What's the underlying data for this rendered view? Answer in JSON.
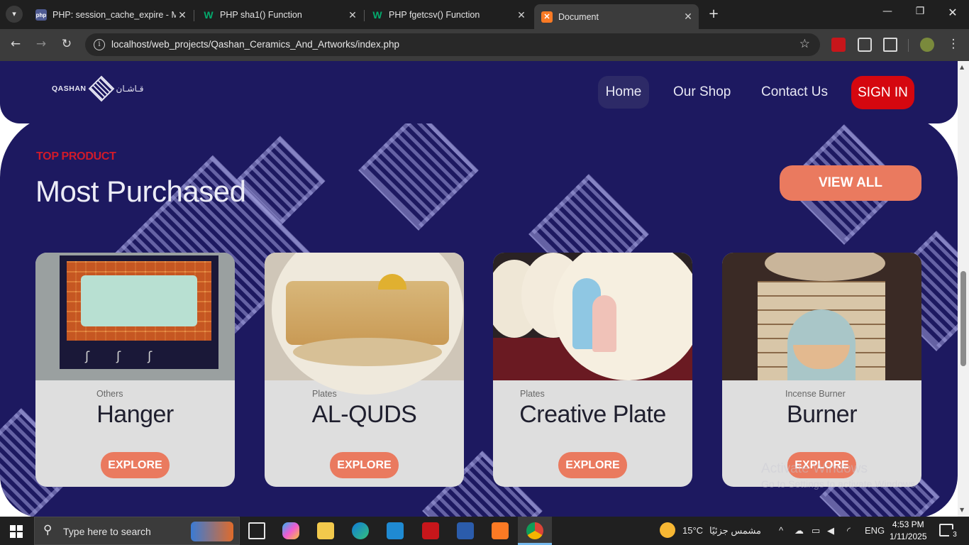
{
  "browser": {
    "tabs": [
      {
        "title": "PHP: session_cache_expire - Ma",
        "icon": "php-icon"
      },
      {
        "title": "PHP sha1() Function",
        "icon": "w3schools-icon"
      },
      {
        "title": "PHP fgetcsv() Function",
        "icon": "w3schools-icon"
      },
      {
        "title": "Document",
        "icon": "xampp-icon"
      }
    ],
    "url": "localhost/web_projects/Qashan_Ceramics_And_Artworks/index.php"
  },
  "site": {
    "logo_en": "QASHAN",
    "logo_ar": "قـاشـان",
    "nav": {
      "home": "Home",
      "shop": "Our Shop",
      "contact": "Contact Us",
      "signin": "SIGN IN"
    },
    "section": {
      "eyebrow": "TOP PRODUCT",
      "title": "Most Purchased",
      "view_all": "VIEW ALL"
    },
    "products": [
      {
        "category": "Others",
        "name": "Hanger",
        "button": "EXPLORE"
      },
      {
        "category": "Plates",
        "name": "AL-QUDS",
        "button": "EXPLORE"
      },
      {
        "category": "Plates",
        "name": "Creative Plate",
        "button": "EXPLORE"
      },
      {
        "category": "Incense Burner",
        "name": "Burner",
        "button": "EXPLORE"
      }
    ],
    "watermark": {
      "line1": "Activate Windows",
      "line2": "Go to Settings to activate Windows."
    }
  },
  "taskbar": {
    "search_placeholder": "Type here to search",
    "weather": "15°C",
    "weather_desc": "مشمس جزئيًا",
    "language": "ENG",
    "time": "4:53 PM",
    "date": "1/11/2025",
    "notifications": "3"
  },
  "colors": {
    "brand": "#1d1960",
    "accent": "#ea7a5f",
    "signin": "#d5070f",
    "eyebrow": "#d11a2a"
  }
}
